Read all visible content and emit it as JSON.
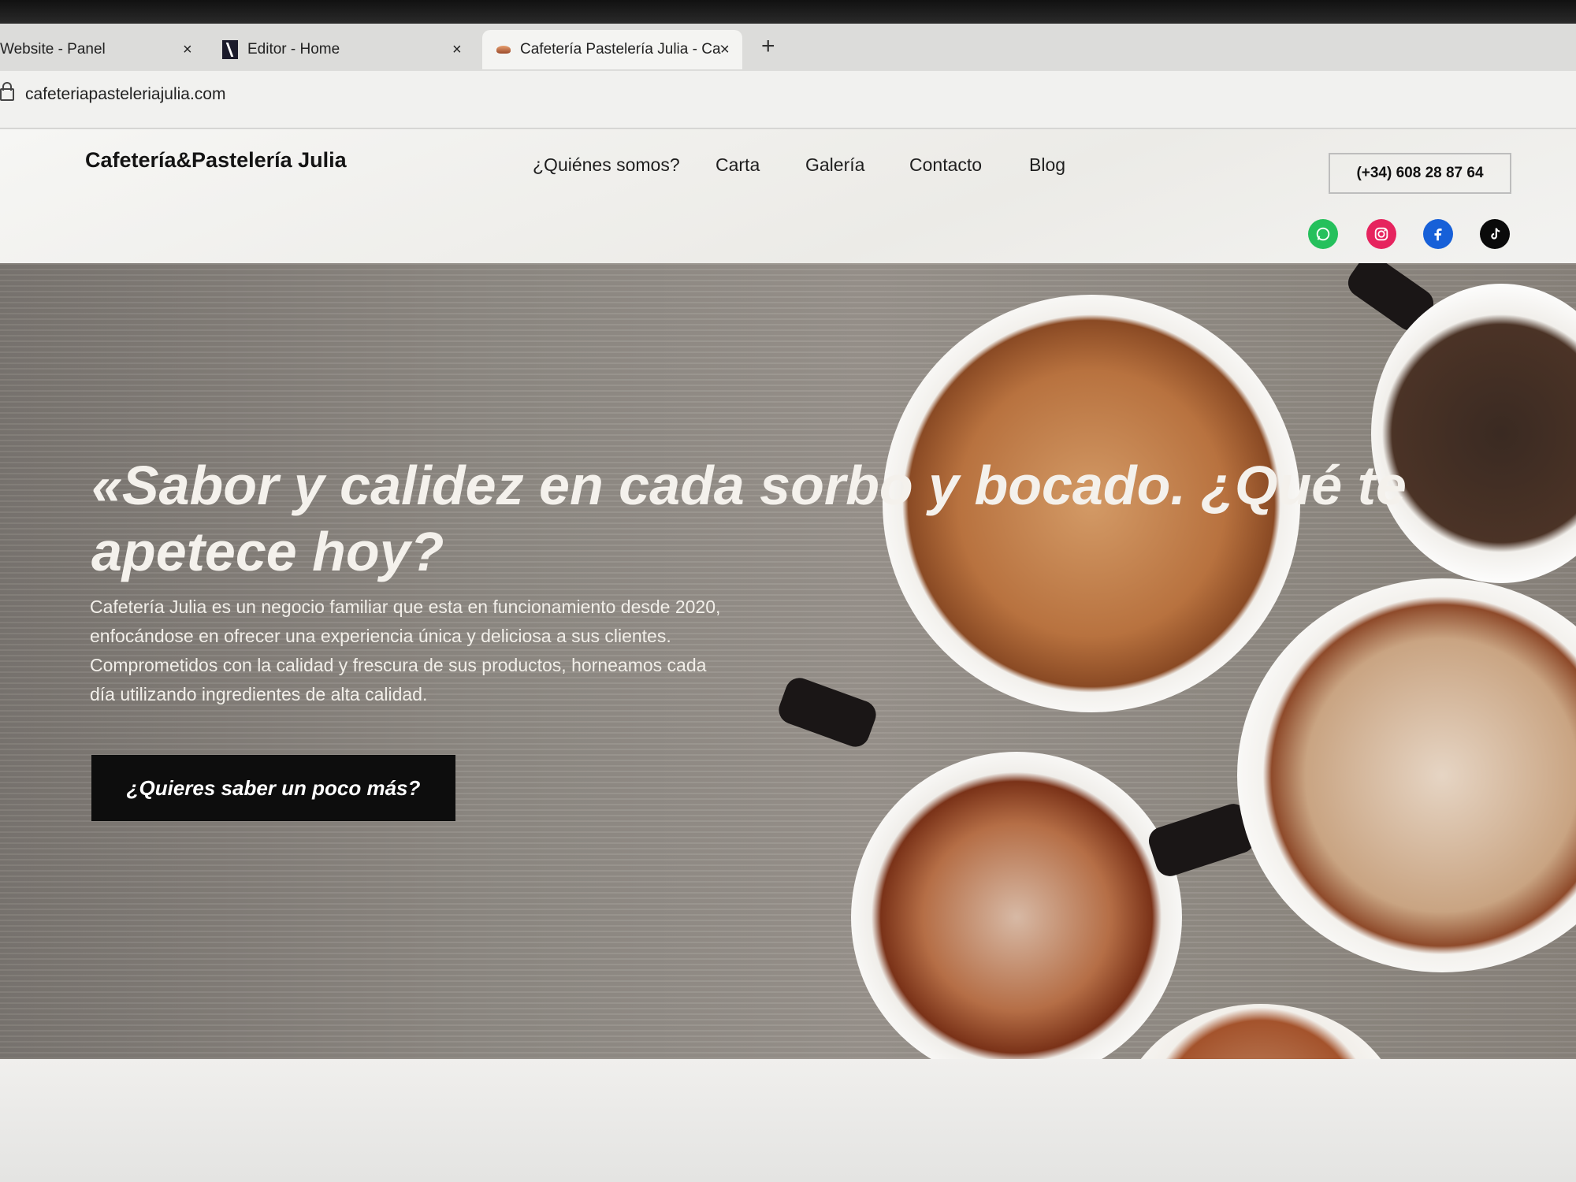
{
  "browser": {
    "tabs": [
      {
        "label": "Website - Panel"
      },
      {
        "label": "Editor - Home"
      },
      {
        "label": "Cafetería Pastelería Julia - Cafet"
      }
    ],
    "close_glyph": "×",
    "new_tab_glyph": "+",
    "url": "cafeteriapasteleriajulia.com"
  },
  "site": {
    "brand": "Cafetería&Pastelería Julia",
    "nav": [
      "¿Quiénes somos?",
      "Carta",
      "Galería",
      "Contacto",
      "Blog"
    ],
    "phone": "(+34) 608 28 87 64",
    "social": [
      {
        "icon": "whatsapp-icon",
        "color": "#25c05c"
      },
      {
        "icon": "instagram-icon",
        "color": "#e6245e"
      },
      {
        "icon": "facebook-icon",
        "color": "#1760d8"
      },
      {
        "icon": "tiktok-icon",
        "color": "#0a0a0a"
      }
    ]
  },
  "hero": {
    "title": "«Sabor y calidez en cada sorbo y bocado. ¿Qué te apetece hoy?",
    "description": "Cafetería Julia es un negocio familiar que esta en funcionamiento desde 2020, enfocándose en ofrecer una experiencia única y deliciosa a sus clientes. Comprometidos con la calidad y frescura de sus productos, horneamos cada día utilizando ingredientes de alta calidad.",
    "cta": "¿Quieres saber un poco más?"
  },
  "colors": {
    "accent_red": "#b0242c",
    "button_bg": "#0d0d0d"
  }
}
